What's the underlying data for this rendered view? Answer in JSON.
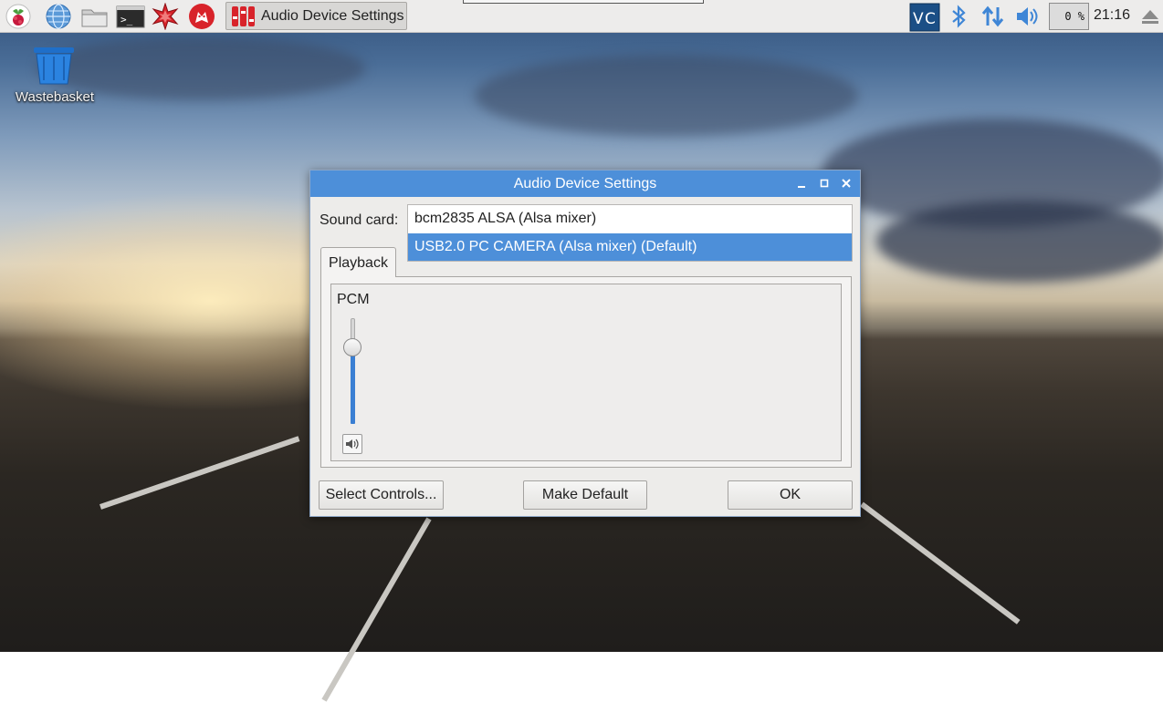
{
  "taskbar": {
    "launchers": [
      "raspberry-menu-icon",
      "web-browser-icon",
      "file-manager-icon",
      "terminal-icon",
      "mathematica-icon",
      "wolfram-icon"
    ],
    "task_button_label": "Audio Device Settings",
    "tray": {
      "vnc_icon": "vnc-icon",
      "bluetooth_icon": "bluetooth-icon",
      "network_icon": "network-updown-icon",
      "volume_icon": "volume-icon",
      "cpu_usage": "0 %",
      "clock": "21:16",
      "eject_icon": "eject-icon"
    }
  },
  "desktop": {
    "wastebasket_label": "Wastebasket"
  },
  "dialog": {
    "title": "Audio Device Settings",
    "sound_card_label": "Sound card:",
    "sound_cards": [
      "bcm2835 ALSA (Alsa mixer)",
      "USB2.0 PC CAMERA (Alsa mixer) (Default)"
    ],
    "selected_sound_card_index": 1,
    "tab_playback": "Playback",
    "control_label": "PCM",
    "pcm_level": 0.72,
    "buttons": {
      "select_controls": "Select Controls...",
      "make_default": "Make Default",
      "ok": "OK"
    },
    "accent_color": "#4d8fd9"
  }
}
